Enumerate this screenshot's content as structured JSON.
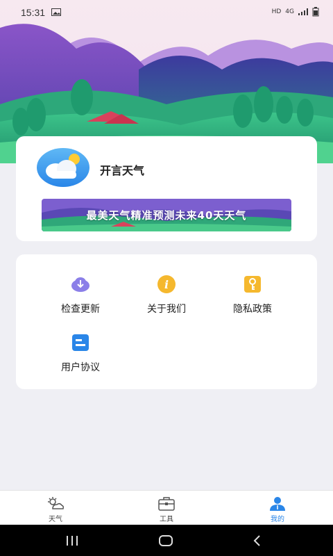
{
  "status_bar": {
    "time": "15:31",
    "network_label": "HD",
    "signal_label": "4G"
  },
  "profile_card": {
    "app_name": "开言天气",
    "banner_text": "最美天气精准预测未来40天天气"
  },
  "menu": {
    "items": [
      {
        "label": "检查更新",
        "icon": "cloud-download-icon"
      },
      {
        "label": "关于我们",
        "icon": "info-icon"
      },
      {
        "label": "隐私政策",
        "icon": "key-icon"
      },
      {
        "label": "用户协议",
        "icon": "document-icon"
      }
    ]
  },
  "tab_bar": {
    "tabs": [
      {
        "label": "天气",
        "icon": "weather-icon",
        "active": false
      },
      {
        "label": "工具",
        "icon": "toolbox-icon",
        "active": false
      },
      {
        "label": "我的",
        "icon": "user-icon",
        "active": true
      }
    ]
  },
  "colors": {
    "accent": "#2a86e8",
    "background": "#efeff4"
  }
}
